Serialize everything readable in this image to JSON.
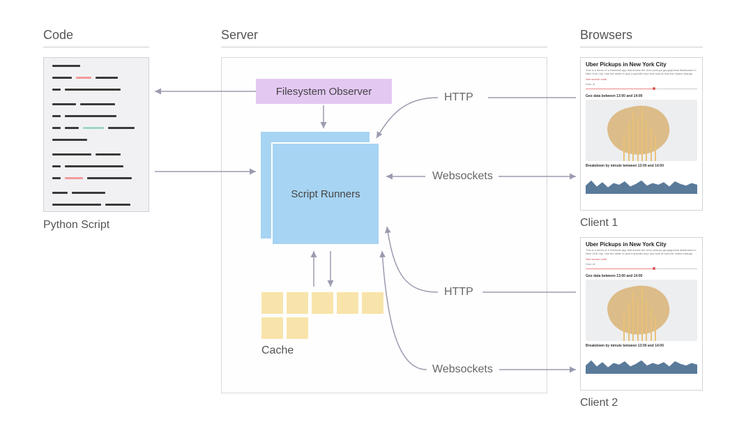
{
  "columns": {
    "code": {
      "title": "Code",
      "caption": "Python Script"
    },
    "server": {
      "title": "Server",
      "filesystem_observer": "Filesystem Observer",
      "script_runners": "Script Runners",
      "cache": "Cache"
    },
    "browsers": {
      "title": "Browsers"
    }
  },
  "connections": {
    "http1": "HTTP",
    "http2": "HTTP",
    "ws1": "Websockets",
    "ws2": "Websockets"
  },
  "clients": [
    {
      "label": "Client 1",
      "page_title": "Uber Pickups in New York City",
      "description": "This is a demo of a Streamlit app that shows the Uber pickups geographical distribution in New York City. Use the slider to pick a specific hour and look at how the charts change.",
      "link": "See source code",
      "slider_label": "Hour of",
      "section1": "Geo data between 13:00 and 14:00",
      "section2": "Breakdown by minute between 13:00 and 14:00"
    },
    {
      "label": "Client 2",
      "page_title": "Uber Pickups in New York City",
      "description": "This is a demo of a Streamlit app that shows the Uber pickups geographical distribution in New York City. Use the slider to pick a specific hour and look at how the charts change.",
      "link": "See source code",
      "slider_label": "Hour of",
      "section1": "Geo data between 13:00 and 14:00",
      "section2": "Breakdown by minute between 13:00 and 14:00"
    }
  ],
  "colors": {
    "purple": "#e3c8f2",
    "blue": "#a7d4f2",
    "yellow": "#f8e4ab",
    "arrow": "#9b9bb0"
  }
}
